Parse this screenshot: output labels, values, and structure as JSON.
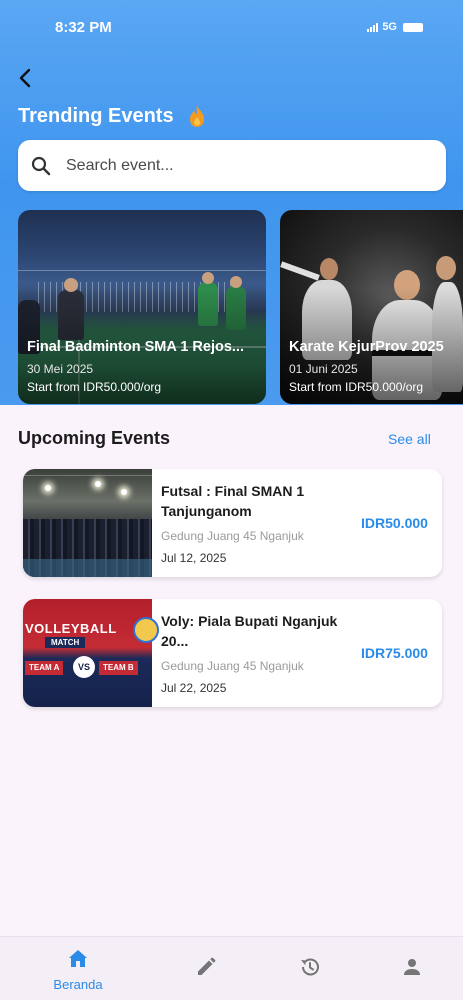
{
  "status_bar": {
    "time": "8:32 PM",
    "network": "5G"
  },
  "header": {
    "title": "Trending Events"
  },
  "search": {
    "placeholder": "Search event..."
  },
  "trending": [
    {
      "title": "Final Badminton SMA 1 Rejos...",
      "date": "30 Mei 2025",
      "price": "Start from IDR50.000/org"
    },
    {
      "title": "Karate KejurProv 2025",
      "date": "01 Juni 2025",
      "price": "Start from IDR50.000/org"
    }
  ],
  "upcoming": {
    "title": "Upcoming Events",
    "see_all": "See all",
    "events": [
      {
        "title": "Futsal : Final SMAN 1 Tanjunganom",
        "venue": "Gedung Juang 45 Nganjuk",
        "date": "Jul 12, 2025",
        "price": "IDR50.000"
      },
      {
        "title": "Voly: Piala Bupati Nganjuk 20...",
        "venue": "Gedung Juang 45 Nganjuk",
        "date": "Jul 22, 2025",
        "price": "IDR75.000",
        "poster": {
          "headline": "VOLLEYBALL",
          "sub": "MATCH",
          "team_a": "TEAM A",
          "team_b": "TEAM B",
          "vs": "VS"
        }
      }
    ]
  },
  "nav": {
    "items": [
      {
        "label": "Beranda",
        "icon": "home-icon",
        "active": true
      },
      {
        "label": "",
        "icon": "pencil-icon",
        "active": false
      },
      {
        "label": "",
        "icon": "history-icon",
        "active": false
      },
      {
        "label": "",
        "icon": "person-icon",
        "active": false
      }
    ]
  },
  "colors": {
    "accent": "#2a8be8",
    "header_top": "#5aa7f4",
    "header_bottom": "#4a9bef",
    "background": "#fbf3fb",
    "nav_icon_inactive": "#757575"
  }
}
